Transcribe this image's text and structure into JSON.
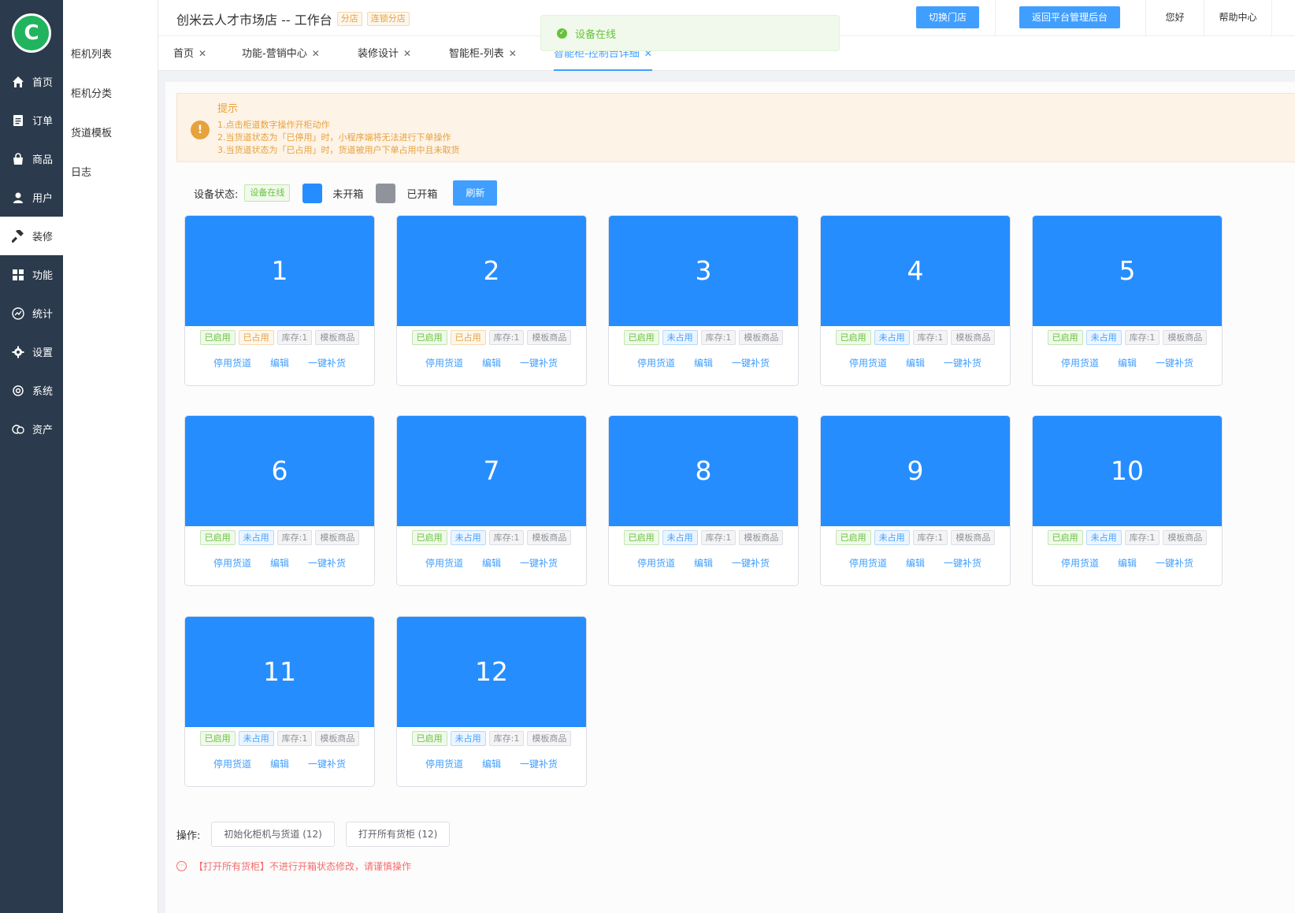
{
  "app": {
    "logo_letter": "C",
    "shop_title": "创米云人才市场店 -- 工作台",
    "badge_branch": "分店",
    "badge_chain": "连锁分店"
  },
  "header": {
    "switch_store": "切换门店",
    "back_platform": "返回平台管理后台",
    "greeting": "您好",
    "help_center": "帮助中心"
  },
  "sidebar": {
    "items": [
      {
        "label": "首页",
        "icon": "home-icon"
      },
      {
        "label": "订单",
        "icon": "order-icon"
      },
      {
        "label": "商品",
        "icon": "bag-icon"
      },
      {
        "label": "用户",
        "icon": "user-icon"
      },
      {
        "label": "装修",
        "icon": "hammer-icon",
        "active": true
      },
      {
        "label": "功能",
        "icon": "grid-icon"
      },
      {
        "label": "统计",
        "icon": "chart-icon"
      },
      {
        "label": "设置",
        "icon": "gear-icon"
      },
      {
        "label": "系统",
        "icon": "system-gear-icon"
      },
      {
        "label": "资产",
        "icon": "coins-icon"
      }
    ]
  },
  "submenu": {
    "items": [
      "柜机列表",
      "柜机分类",
      "货道模板",
      "日志"
    ]
  },
  "tabs": [
    {
      "label": "首页"
    },
    {
      "label": "功能-营销中心"
    },
    {
      "label": "装修设计"
    },
    {
      "label": "智能柜-列表"
    },
    {
      "label": "智能柜-控制台详细",
      "active": true
    }
  ],
  "toast": {
    "text": "设备在线"
  },
  "notice": {
    "title": "提示",
    "lines": [
      "1.点击柜道数字操作开柜动作",
      "2.当货道状态为「已停用」时，小程序端将无法进行下单操作",
      "3.当货道状态为「已占用」时，货道被用户下单占用中且未取货"
    ]
  },
  "status_bar": {
    "label": "设备状态:",
    "device_status": "设备在线",
    "legend_closed": "未开箱",
    "legend_opened": "已开箱",
    "refresh": "刷新",
    "color_closed": "#268dff",
    "color_opened": "#909399"
  },
  "cells": [
    {
      "number": "1",
      "enabled": "已启用",
      "occupancy": "已占用",
      "stock": "库存:1",
      "template": "模板商品"
    },
    {
      "number": "2",
      "enabled": "已启用",
      "occupancy": "已占用",
      "stock": "库存:1",
      "template": "模板商品"
    },
    {
      "number": "3",
      "enabled": "已启用",
      "occupancy": "未占用",
      "stock": "库存:1",
      "template": "模板商品"
    },
    {
      "number": "4",
      "enabled": "已启用",
      "occupancy": "未占用",
      "stock": "库存:1",
      "template": "模板商品"
    },
    {
      "number": "5",
      "enabled": "已启用",
      "occupancy": "未占用",
      "stock": "库存:1",
      "template": "模板商品"
    },
    {
      "number": "6",
      "enabled": "已启用",
      "occupancy": "未占用",
      "stock": "库存:1",
      "template": "模板商品"
    },
    {
      "number": "7",
      "enabled": "已启用",
      "occupancy": "未占用",
      "stock": "库存:1",
      "template": "模板商品"
    },
    {
      "number": "8",
      "enabled": "已启用",
      "occupancy": "未占用",
      "stock": "库存:1",
      "template": "模板商品"
    },
    {
      "number": "9",
      "enabled": "已启用",
      "occupancy": "未占用",
      "stock": "库存:1",
      "template": "模板商品"
    },
    {
      "number": "10",
      "enabled": "已启用",
      "occupancy": "未占用",
      "stock": "库存:1",
      "template": "模板商品"
    },
    {
      "number": "11",
      "enabled": "已启用",
      "occupancy": "未占用",
      "stock": "库存:1",
      "template": "模板商品"
    },
    {
      "number": "12",
      "enabled": "已启用",
      "occupancy": "未占用",
      "stock": "库存:1",
      "template": "模板商品"
    }
  ],
  "cell_actions": {
    "disable": "停用货道",
    "edit": "编辑",
    "restock": "一键补货"
  },
  "operations": {
    "label": "操作:",
    "init_button": "初始化柜机与货道 (12)",
    "open_all_button": "打开所有货柜 (12)",
    "caution": "【打开所有货柜】不进行开箱状态修改，请谨慎操作"
  }
}
